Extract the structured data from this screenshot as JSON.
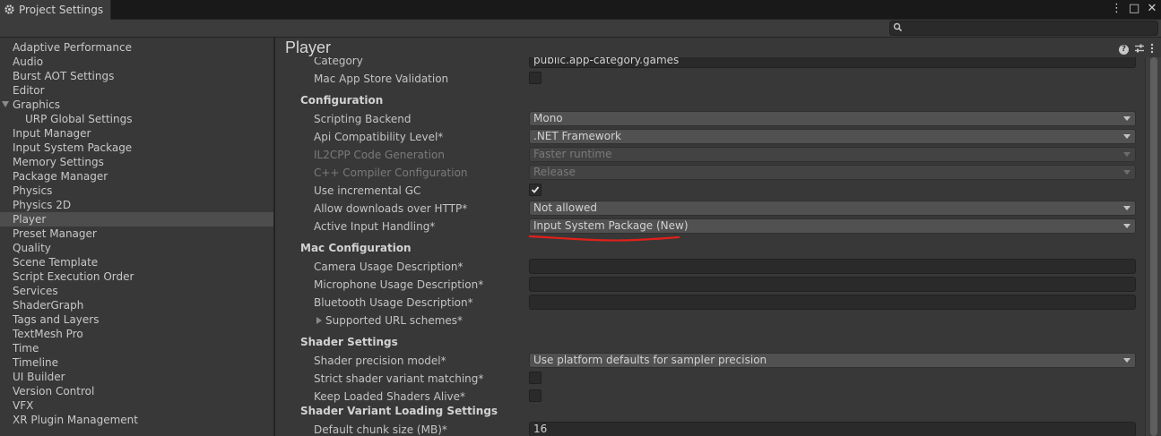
{
  "window": {
    "tab_title": "Project Settings",
    "controls": [
      "⋮",
      "□",
      "✕"
    ],
    "search_placeholder": ""
  },
  "sidebar": {
    "items": [
      {
        "label": "Adaptive Performance"
      },
      {
        "label": "Audio"
      },
      {
        "label": "Burst AOT Settings"
      },
      {
        "label": "Editor"
      },
      {
        "label": "Graphics",
        "expanded": true
      },
      {
        "label": "URP Global Settings",
        "sub": true
      },
      {
        "label": "Input Manager"
      },
      {
        "label": "Input System Package"
      },
      {
        "label": "Memory Settings"
      },
      {
        "label": "Package Manager"
      },
      {
        "label": "Physics"
      },
      {
        "label": "Physics 2D"
      },
      {
        "label": "Player",
        "selected": true
      },
      {
        "label": "Preset Manager"
      },
      {
        "label": "Quality"
      },
      {
        "label": "Scene Template"
      },
      {
        "label": "Script Execution Order"
      },
      {
        "label": "Services"
      },
      {
        "label": "ShaderGraph"
      },
      {
        "label": "Tags and Layers"
      },
      {
        "label": "TextMesh Pro"
      },
      {
        "label": "Time"
      },
      {
        "label": "Timeline"
      },
      {
        "label": "UI Builder"
      },
      {
        "label": "Version Control"
      },
      {
        "label": "VFX"
      },
      {
        "label": "XR Plugin Management"
      }
    ]
  },
  "main": {
    "title": "Player",
    "header_icons": [
      "help-icon",
      "sliders-icon",
      "kebab-menu-icon"
    ],
    "category": {
      "label": "Category",
      "value": "public.app-category.games"
    },
    "mac_app_store_validation": {
      "label": "Mac App Store Validation",
      "checked": false
    },
    "configuration": {
      "heading": "Configuration",
      "scripting_backend": {
        "label": "Scripting Backend",
        "value": "Mono"
      },
      "api_compat": {
        "label": "Api Compatibility Level*",
        "value": ".NET Framework"
      },
      "il2cpp_codegen": {
        "label": "IL2CPP Code Generation",
        "value": "Faster runtime"
      },
      "cpp_compiler": {
        "label": "C++ Compiler Configuration",
        "value": "Release"
      },
      "incremental_gc": {
        "label": "Use incremental GC",
        "checked": true
      },
      "http_downloads": {
        "label": "Allow downloads over HTTP*",
        "value": "Not allowed"
      },
      "active_input": {
        "label": "Active Input Handling*",
        "value": "Input System Package (New)"
      }
    },
    "mac_configuration": {
      "heading": "Mac Configuration",
      "camera_usage": {
        "label": "Camera Usage Description*",
        "value": ""
      },
      "microphone_usage": {
        "label": "Microphone Usage Description*",
        "value": ""
      },
      "bluetooth_usage": {
        "label": "Bluetooth Usage Description*",
        "value": ""
      },
      "url_schemes": {
        "label": "Supported URL schemes*"
      }
    },
    "shader_settings": {
      "heading": "Shader Settings",
      "precision_model": {
        "label": "Shader precision model*",
        "value": "Use platform defaults for sampler precision"
      },
      "strict_matching": {
        "label": "Strict shader variant matching*",
        "checked": false
      },
      "keep_loaded": {
        "label": "Keep Loaded Shaders Alive*",
        "checked": false
      }
    },
    "shader_variant_loading": {
      "heading": "Shader Variant Loading Settings",
      "chunk_size": {
        "label": "Default chunk size (MB)*",
        "value": "16"
      }
    }
  },
  "colors": {
    "annotation_red": "#e0201a",
    "background": "#383838",
    "selected": "#4d4d4d"
  }
}
